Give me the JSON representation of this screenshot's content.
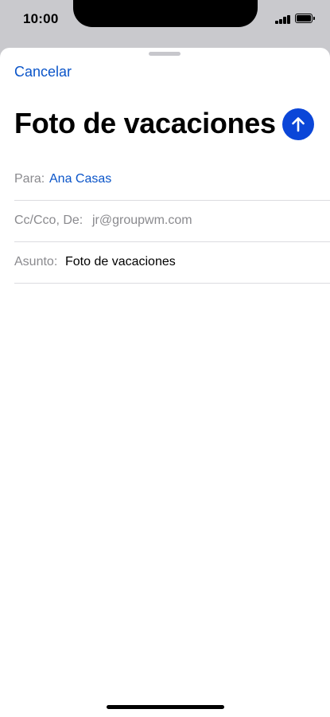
{
  "status_bar": {
    "time": "10:00"
  },
  "compose": {
    "cancel_label": "Cancelar",
    "title": "Foto de vacaciones",
    "send_icon": "arrow-up-icon",
    "accent_color": "#0b46d8",
    "to": {
      "label": "Para:",
      "value": "Ana Casas"
    },
    "cc": {
      "label": "Cc/Cco, De:",
      "value": "jr@groupwm.com"
    },
    "subject": {
      "label": "Asunto:",
      "value": "Foto de vacaciones"
    }
  }
}
